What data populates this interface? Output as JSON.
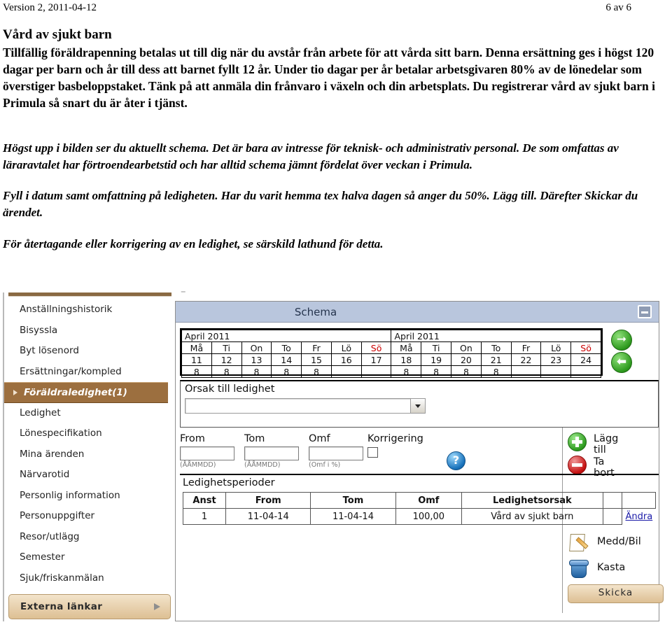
{
  "document": {
    "header_left": "Version 2, 2011-04-12",
    "header_right": "6 av 6",
    "title": "Vård av sjukt barn",
    "body_paragraph": "Tillfällig föräldrapenning betalas ut till dig när du avstår från arbete för att vårda sitt barn. Denna ersättning ges i högst 120 dagar per barn och år till dess att barnet fyllt 12 år. Under tio dagar per år betalar arbetsgivaren 80% av de lönedelar som överstiger basbeloppstaket. Tänk på att anmäla din frånvaro i växeln och din arbetsplats. Du registrerar vård av sjukt barn i Primula så snart du är åter i tjänst.",
    "italic_paragraphs": [
      "Högst upp i bilden ser du aktuellt schema. Det är bara av intresse för teknisk- och administrativ personal. De som omfattas av läraravtalet har förtroendearbetstid och har alltid schema jämnt fördelat över veckan i Primula.",
      "Fyll i datum samt omfattning på ledigheten. Har du varit hemma tex halva dagen så anger du 50%. Lägg till. Därefter Skickar du ärendet.",
      "För återtagande eller korrigering av en ledighet, se särskild lathund för detta."
    ]
  },
  "app": {
    "sidebar": {
      "items": [
        {
          "label": "Anställningshistorik",
          "selected": false
        },
        {
          "label": "Bisyssla",
          "selected": false
        },
        {
          "label": "Byt lösenord",
          "selected": false
        },
        {
          "label": "Ersättningar/kompled",
          "selected": false
        },
        {
          "label": "Föräldraledighet(1)",
          "selected": true
        },
        {
          "label": "Ledighet",
          "selected": false
        },
        {
          "label": "Lönespecifikation",
          "selected": false
        },
        {
          "label": "Mina ärenden",
          "selected": false
        },
        {
          "label": "Närvarotid",
          "selected": false
        },
        {
          "label": "Personlig information",
          "selected": false
        },
        {
          "label": "Personuppgifter",
          "selected": false
        },
        {
          "label": "Resor/utlägg",
          "selected": false
        },
        {
          "label": "Semester",
          "selected": false
        },
        {
          "label": "Sjuk/friskanmälan",
          "selected": false
        }
      ],
      "external_links": "Externa länkar"
    },
    "panel": {
      "title": "Schema",
      "minimize_label": "–"
    },
    "schema": {
      "month_left": "April 2011",
      "month_right": "April 2011",
      "weekday_headers": [
        "Må",
        "Ti",
        "On",
        "To",
        "Fr",
        "Lö",
        "Sö",
        "Må",
        "Ti",
        "On",
        "To",
        "Fr",
        "Lö",
        "Sö"
      ],
      "sunday_indices": [
        6,
        13
      ],
      "days": [
        "11",
        "12",
        "13",
        "14",
        "15",
        "16",
        "17",
        "18",
        "19",
        "20",
        "21",
        "22",
        "23",
        "24"
      ],
      "hours": [
        "8",
        "8",
        "8",
        "8",
        "8",
        "",
        "",
        "8",
        "8",
        "8",
        "8",
        "",
        "",
        ""
      ],
      "next_icon": "arrow-right-icon",
      "prev_icon": "arrow-left-icon"
    },
    "form": {
      "reason_label": "Orsak till ledighet",
      "reason_value": "",
      "from_label": "From",
      "from_value": "",
      "from_hint": "(ÅÅMMDD)",
      "tom_label": "Tom",
      "tom_value": "",
      "tom_hint": "(ÅÅMMDD)",
      "omf_label": "Omf",
      "omf_value": "",
      "omf_hint": "(Omf i %)",
      "korrigering_label": "Korrigering",
      "help_label": "?"
    },
    "actions": {
      "add_label": "Lägg till",
      "delete_label": "Ta bort"
    },
    "periods": {
      "title": "Ledighetsperioder",
      "columns": [
        "Anst",
        "From",
        "Tom",
        "Omf",
        "Ledighetsorsak",
        "",
        ""
      ],
      "rows": [
        {
          "anst": "1",
          "from": "11-04-14",
          "tom": "11-04-14",
          "omf": "100,00",
          "orsak": "Vård av sjukt barn",
          "spacer": "",
          "edit": "Ändra"
        }
      ]
    },
    "bottom": {
      "message_label": "Medd/Bil",
      "discard_label": "Kasta",
      "send_label": "Skicka"
    },
    "colors": {
      "sidebar_selected": "#9c6f3f",
      "panel_title": "#b9c6dd",
      "sunday_red": "#cc0000",
      "link_blue": "#1a1aa8",
      "beige_button": "#ddbf93"
    }
  }
}
